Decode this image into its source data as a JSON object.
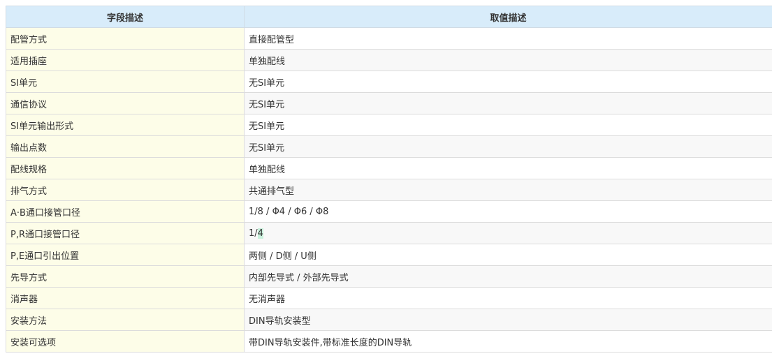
{
  "header": {
    "col1": "字段描述",
    "col2": "取值描述"
  },
  "rows": [
    {
      "label": "配管方式",
      "value": "直接配管型"
    },
    {
      "label": "适用插座",
      "value": "单独配线"
    },
    {
      "label": "SI单元",
      "value": "无SI单元"
    },
    {
      "label": "通信协议",
      "value": "无SI单元"
    },
    {
      "label": "SI单元输出形式",
      "value": "无SI单元"
    },
    {
      "label": "输出点数",
      "value": "无SI单元"
    },
    {
      "label": "配线规格",
      "value": "单独配线"
    },
    {
      "label": "排气方式",
      "value": "共通排气型"
    },
    {
      "label": "A·B通口接管口径",
      "value": "1/8 / Φ4 / Φ6 / Φ8"
    },
    {
      "label": "P,R通口接管口径",
      "value": "1/",
      "value_highlight": "4"
    },
    {
      "label": "P,E通口引出位置",
      "value": "两侧 / D侧 / U侧"
    },
    {
      "label": "先导方式",
      "value": "内部先导式 / 外部先导式"
    },
    {
      "label": "消声器",
      "value": "无消声器"
    },
    {
      "label": "安装方法",
      "value": "DIN导轨安装型"
    },
    {
      "label": "安装可选项",
      "value": "带DIN导轨安装件,带标准长度的DIN导轨"
    }
  ]
}
